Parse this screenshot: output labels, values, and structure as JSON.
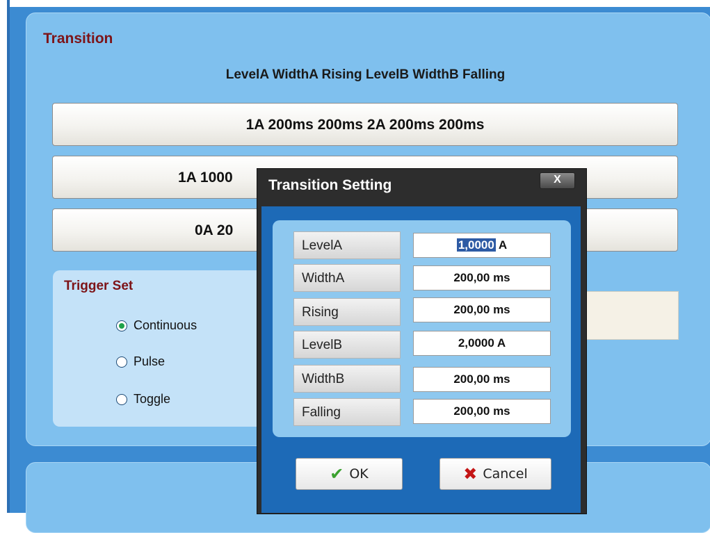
{
  "transition": {
    "title": "Transition",
    "column_header": "LevelA WidthA Rising LevelB WidthB Falling",
    "presets": [
      {
        "label": "1A 200ms 200ms 2A 200ms 200ms"
      },
      {
        "label": "1A 1000"
      },
      {
        "label": "0A 20"
      }
    ]
  },
  "trigger": {
    "title": "Trigger Set",
    "options": [
      {
        "label": "Continuous",
        "checked": true
      },
      {
        "label": "Pulse",
        "checked": false
      },
      {
        "label": "Toggle",
        "checked": false
      }
    ]
  },
  "dialog": {
    "title": "Transition Setting",
    "close_label": "X",
    "fields": [
      {
        "label": "LevelA",
        "value_selected": "1,0000",
        "unit": "A"
      },
      {
        "label": "WidthA",
        "value": "200,00 ms"
      },
      {
        "label": "Rising",
        "value": "200,00 ms"
      },
      {
        "label": "LevelB",
        "value": "2,0000 A"
      },
      {
        "label": "WidthB",
        "value": "200,00 ms"
      },
      {
        "label": "Falling",
        "value": "200,00 ms"
      }
    ],
    "ok_label": "OK",
    "cancel_label": "Cancel"
  },
  "colors": {
    "title_red": "#7d1418",
    "background_blue": "#3c8bd2",
    "panel_blue": "#7fc0ee",
    "dialog_blue": "#1d6ab7",
    "selection_blue": "#2d5aa4"
  }
}
